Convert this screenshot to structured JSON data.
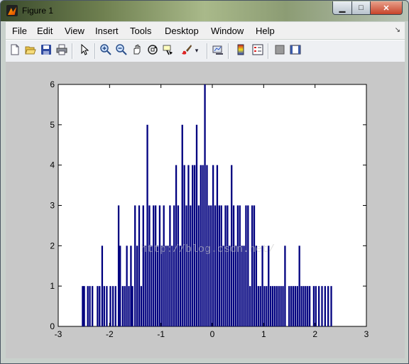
{
  "window": {
    "title": "Figure 1",
    "min_label": "▁",
    "max_label": "□",
    "close_label": "✕"
  },
  "menubar": [
    "File",
    "Edit",
    "View",
    "Insert",
    "Tools",
    "Desktop",
    "Window",
    "Help"
  ],
  "menubar_arrow": "↘",
  "toolbar": {
    "icons": [
      "new-figure-icon",
      "open-file-icon",
      "save-icon",
      "print-icon",
      "pointer-icon",
      "zoom-in-icon",
      "zoom-out-icon",
      "pan-icon",
      "rotate-3d-icon",
      "data-cursor-icon",
      "brush-icon",
      "dropdown-arrow-icon",
      "link-plot-icon",
      "colorbar-icon",
      "legend-icon",
      "hide-plot-tools-icon",
      "show-plot-tools-icon"
    ]
  },
  "watermark": "http://blog.csdn.net/",
  "colors": {
    "bar": "#00007f",
    "axes_bg": "#ffffff",
    "figure_bg": "#c8c8c8"
  },
  "chart_data": {
    "type": "bar",
    "xlim": [
      -3,
      3
    ],
    "ylim": [
      0,
      6
    ],
    "xticks": [
      "-3",
      "-2",
      "-1",
      "0",
      "1",
      "2",
      "3"
    ],
    "yticks": [
      "0",
      "1",
      "2",
      "3",
      "4",
      "5",
      "6"
    ],
    "bar_color": "#00007f",
    "x": [
      -2.52,
      -2.49,
      -2.45,
      -2.42,
      -2.38,
      -2.33,
      -2.28,
      -2.23,
      -2.19,
      -2.14,
      -2.1,
      -2.05,
      -2.02,
      -1.98,
      -1.93,
      -1.88,
      -1.82,
      -1.79,
      -1.74,
      -1.7,
      -1.66,
      -1.62,
      -1.58,
      -1.55,
      -1.5,
      -1.46,
      -1.42,
      -1.38,
      -1.34,
      -1.3,
      -1.26,
      -1.22,
      -1.18,
      -1.14,
      -1.1,
      -1.06,
      -1.02,
      -0.98,
      -0.94,
      -0.9,
      -0.86,
      -0.82,
      -0.78,
      -0.74,
      -0.7,
      -0.66,
      -0.62,
      -0.58,
      -0.54,
      -0.5,
      -0.46,
      -0.42,
      -0.38,
      -0.34,
      -0.3,
      -0.26,
      -0.22,
      -0.18,
      -0.14,
      -0.1,
      -0.06,
      -0.02,
      0.02,
      0.06,
      0.1,
      0.14,
      0.18,
      0.22,
      0.26,
      0.3,
      0.34,
      0.38,
      0.42,
      0.46,
      0.5,
      0.54,
      0.58,
      0.62,
      0.66,
      0.7,
      0.74,
      0.78,
      0.82,
      0.86,
      0.9,
      0.94,
      0.98,
      1.02,
      1.06,
      1.1,
      1.14,
      1.18,
      1.22,
      1.26,
      1.3,
      1.34,
      1.38,
      1.42,
      1.46,
      1.5,
      1.54,
      1.58,
      1.62,
      1.66,
      1.7,
      1.74,
      1.78,
      1.82,
      1.86,
      1.9,
      1.94,
      1.98,
      2.02,
      2.08,
      2.14,
      2.2,
      2.26,
      2.32,
      2.38
    ],
    "values": [
      1,
      1,
      0,
      1,
      1,
      1,
      0,
      1,
      1,
      2,
      1,
      1,
      0,
      1,
      1,
      1,
      3,
      2,
      1,
      1,
      2,
      1,
      2,
      1,
      3,
      2,
      3,
      1,
      3,
      2,
      5,
      3,
      2,
      3,
      3,
      2,
      3,
      2,
      3,
      2,
      2,
      3,
      2,
      3,
      4,
      3,
      2,
      5,
      4,
      3,
      4,
      3,
      4,
      4,
      5,
      3,
      4,
      4,
      6,
      4,
      3,
      3,
      4,
      3,
      4,
      3,
      3,
      2,
      3,
      3,
      2,
      4,
      3,
      2,
      3,
      3,
      2,
      2,
      3,
      3,
      1,
      3,
      3,
      2,
      1,
      1,
      2,
      1,
      1,
      2,
      1,
      1,
      1,
      1,
      1,
      1,
      1,
      2,
      0,
      1,
      1,
      1,
      1,
      1,
      2,
      1,
      1,
      1,
      1,
      1,
      0,
      1,
      1,
      1,
      1,
      1,
      1,
      1
    ],
    "bar_width": 0.04
  }
}
